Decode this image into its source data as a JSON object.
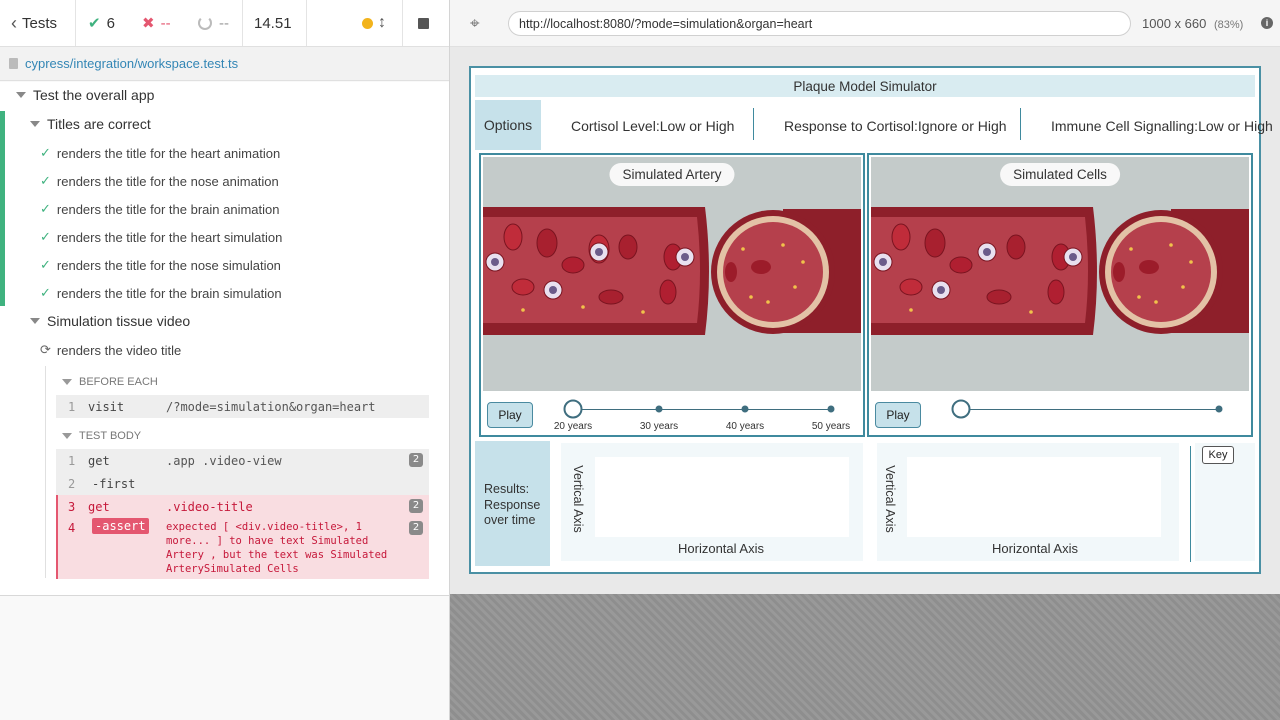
{
  "reporter": {
    "back_label": "Tests",
    "passed": "6",
    "failed": "--",
    "pending": "--",
    "duration": "14.51",
    "spec_path": "cypress/integration/workspace.test.ts",
    "suite_root": "Test the overall app",
    "suite_titles": "Titles are correct",
    "tests": [
      "renders the title for the heart animation",
      "renders the title for the nose animation",
      "renders the title for the brain animation",
      "renders the title for the heart simulation",
      "renders the title for the nose simulation",
      "renders the title for the brain simulation"
    ],
    "suite_video": "Simulation tissue video",
    "running_test": "renders the video title",
    "before_each_label": "BEFORE EACH",
    "test_body_label": "TEST BODY",
    "before_cmd": {
      "num": "1",
      "name": "visit",
      "msg": "/?mode=simulation&organ=heart"
    },
    "body_cmds": [
      {
        "num": "1",
        "name": "get",
        "msg": ".app .video-view",
        "count": "2"
      },
      {
        "num": "2",
        "name": "-first",
        "msg": ""
      },
      {
        "num": "3",
        "name": "get",
        "msg": ".video-title",
        "count": "2"
      },
      {
        "num": "4",
        "name": "-assert",
        "count": "2",
        "msg_lines": [
          "expected [ <div.video-title>, 1",
          "more... ] to have text  Simulated",
          "Artery , but the text was  Simulated",
          "ArterySimulated Cells"
        ]
      }
    ]
  },
  "aut": {
    "url": "http://localhost:8080/?mode=simulation&organ=heart",
    "viewport": "1000 x 660",
    "scale": "(83%)"
  },
  "app": {
    "title": "Plaque Model Simulator",
    "options_label": "Options",
    "options": [
      "Cortisol Level:Low or High",
      "Response to Cortisol:Ignore or High",
      "Immune Cell Signalling:Low or High"
    ],
    "panels": [
      {
        "title": "Simulated Artery",
        "play": "Play",
        "ticks": [
          "20 years",
          "30 years",
          "40 years",
          "50 years"
        ]
      },
      {
        "title": "Simulated Cells",
        "play": "Play",
        "ticks": []
      }
    ],
    "results_label": "Results: Response over time",
    "vertical_axis": "Vertical Axis",
    "horizontal_axis": "Horizontal Axis",
    "key_label": "Key"
  },
  "colors": {
    "pass": "#3fb27f",
    "fail": "#e45770",
    "accent": "#3f8a9e"
  }
}
